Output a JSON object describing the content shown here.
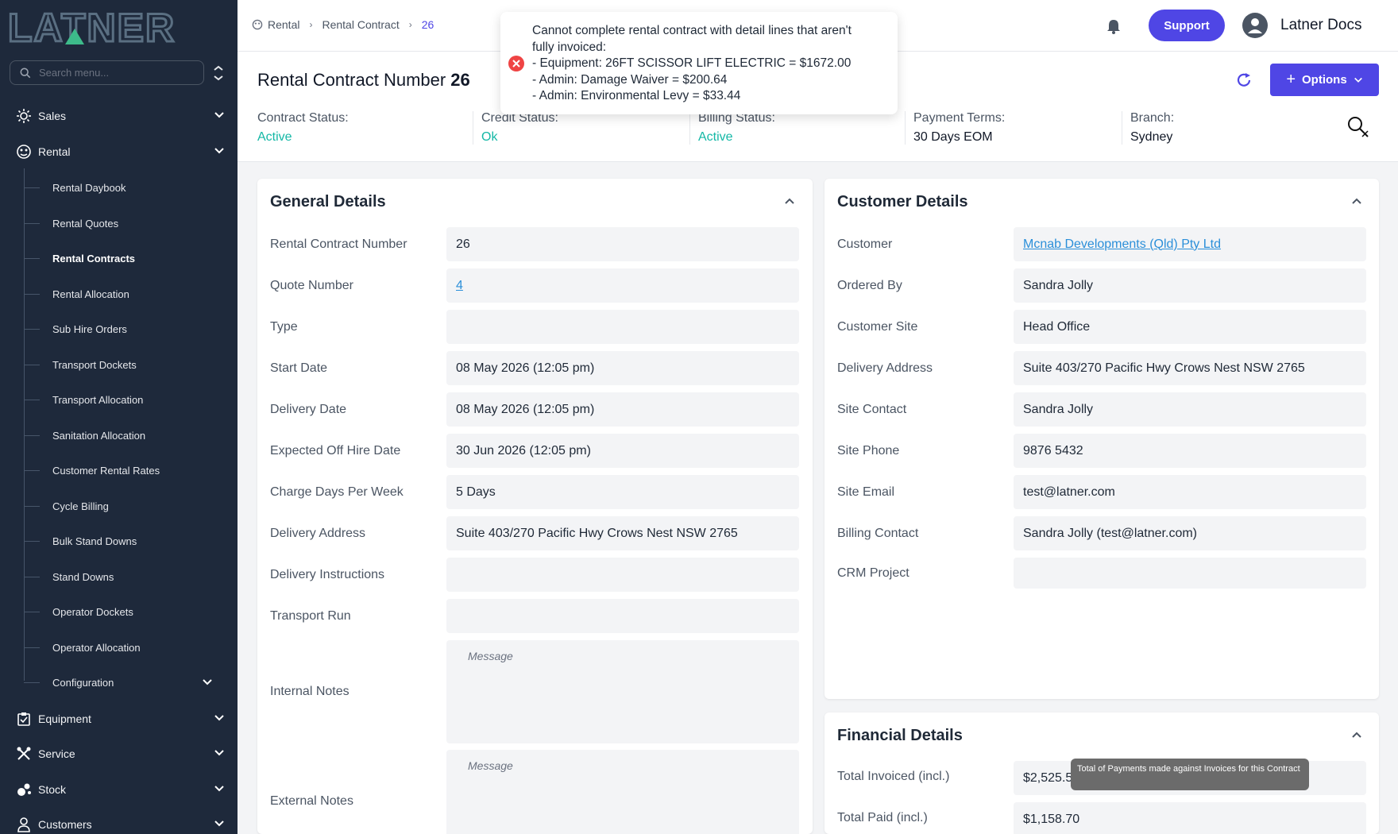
{
  "logo": {
    "text": "LATNER"
  },
  "sidebar": {
    "search_placeholder": "Search menu...",
    "top_items": [
      {
        "label": "Sales",
        "icon": "sales-icon"
      },
      {
        "label": "Rental",
        "icon": "rental-icon"
      },
      {
        "label": "Equipment",
        "icon": "equipment-icon"
      },
      {
        "label": "Service",
        "icon": "service-icon"
      },
      {
        "label": "Stock",
        "icon": "stock-icon"
      },
      {
        "label": "Customers",
        "icon": "customers-icon"
      }
    ],
    "rental_items": [
      {
        "label": "Rental Daybook"
      },
      {
        "label": "Rental Quotes"
      },
      {
        "label": "Rental Contracts",
        "active": true
      },
      {
        "label": "Rental Allocation"
      },
      {
        "label": "Sub Hire Orders"
      },
      {
        "label": "Transport Dockets"
      },
      {
        "label": "Transport Allocation"
      },
      {
        "label": "Sanitation Allocation"
      },
      {
        "label": "Customer Rental Rates"
      },
      {
        "label": "Cycle Billing"
      },
      {
        "label": "Bulk Stand Downs"
      },
      {
        "label": "Stand Downs"
      },
      {
        "label": "Operator Dockets"
      },
      {
        "label": "Operator Allocation"
      },
      {
        "label": "Configuration"
      }
    ]
  },
  "header": {
    "breadcrumb": [
      "Rental",
      "Rental Contract",
      "26"
    ],
    "support_label": "Support",
    "user_name": "Latner Docs"
  },
  "toast": {
    "type": "error",
    "message_line1": "Cannot complete rental contract with detail lines that aren't",
    "message_line2": "fully invoiced:",
    "lines": [
      "- Equipment: 26FT SCISSOR LIFT ELECTRIC = $1672.00",
      "- Admin: Damage Waiver = $200.64",
      "- Admin: Environmental Levy = $33.44"
    ]
  },
  "titlebar": {
    "title": "Rental Contract Number",
    "number": "26",
    "options_label": "Options",
    "statuses": [
      {
        "label": "Contract Status:",
        "value": "Active",
        "color": "#14b8a6"
      },
      {
        "label": "Credit Status:",
        "value": "Ok",
        "color": "#14b8a6"
      },
      {
        "label": "Billing Status:",
        "value": "Active",
        "color": "#14b8a6"
      },
      {
        "label": "Payment Terms:",
        "value": "30 Days EOM"
      },
      {
        "label": "Branch:",
        "value": "Sydney"
      }
    ]
  },
  "general": {
    "title": "General Details",
    "rows": [
      {
        "label": "Rental Contract Number",
        "value": "26"
      },
      {
        "label": "Quote Number",
        "value": "4",
        "link": true
      },
      {
        "label": "Type",
        "value": ""
      },
      {
        "label": "Start Date",
        "value": "08 May 2026 (12:05 pm)"
      },
      {
        "label": "Delivery Date",
        "value": "08 May 2026 (12:05 pm)"
      },
      {
        "label": "Expected Off Hire Date",
        "value": "30 Jun 2026 (12:05 pm)"
      },
      {
        "label": "Charge Days Per Week",
        "value": "5 Days"
      },
      {
        "label": "Delivery Address",
        "value": "Suite 403/270 Pacific Hwy Crows Nest NSW 2765"
      },
      {
        "label": "Delivery Instructions",
        "value": ""
      },
      {
        "label": "Transport Run",
        "value": ""
      }
    ],
    "internal_notes_label": "Internal Notes",
    "external_notes_label": "External Notes",
    "notes_placeholder": "Message"
  },
  "customer": {
    "title": "Customer Details",
    "rows": [
      {
        "label": "Customer",
        "value": "Mcnab Developments (Qld) Pty Ltd",
        "link": true
      },
      {
        "label": "Ordered By",
        "value": "Sandra Jolly"
      },
      {
        "label": "Customer Site",
        "value": "Head Office"
      },
      {
        "label": "Delivery Address",
        "value": "Suite 403/270 Pacific Hwy Crows Nest NSW 2765"
      },
      {
        "label": "Site Contact",
        "value": "Sandra Jolly"
      },
      {
        "label": "Site Phone",
        "value": "9876 5432"
      },
      {
        "label": "Site Email",
        "value": "test@latner.com"
      },
      {
        "label": "Billing Contact",
        "value": "Sandra Jolly (test@latner.com)"
      },
      {
        "label": "CRM Project",
        "value": ""
      }
    ]
  },
  "financial": {
    "title": "Financial Details",
    "rows": [
      {
        "label": "Total Invoiced (incl.)",
        "value": "$2,525.5"
      },
      {
        "label": "Total Paid (incl.)",
        "value": "$1,158.70"
      }
    ],
    "tooltip": "Total of Payments made against Invoices for this Contract"
  },
  "colors": {
    "sidebar": "#1e293b",
    "accent": "#4f46e5",
    "teal": "#14b8a6",
    "link": "#2b8fd9"
  }
}
